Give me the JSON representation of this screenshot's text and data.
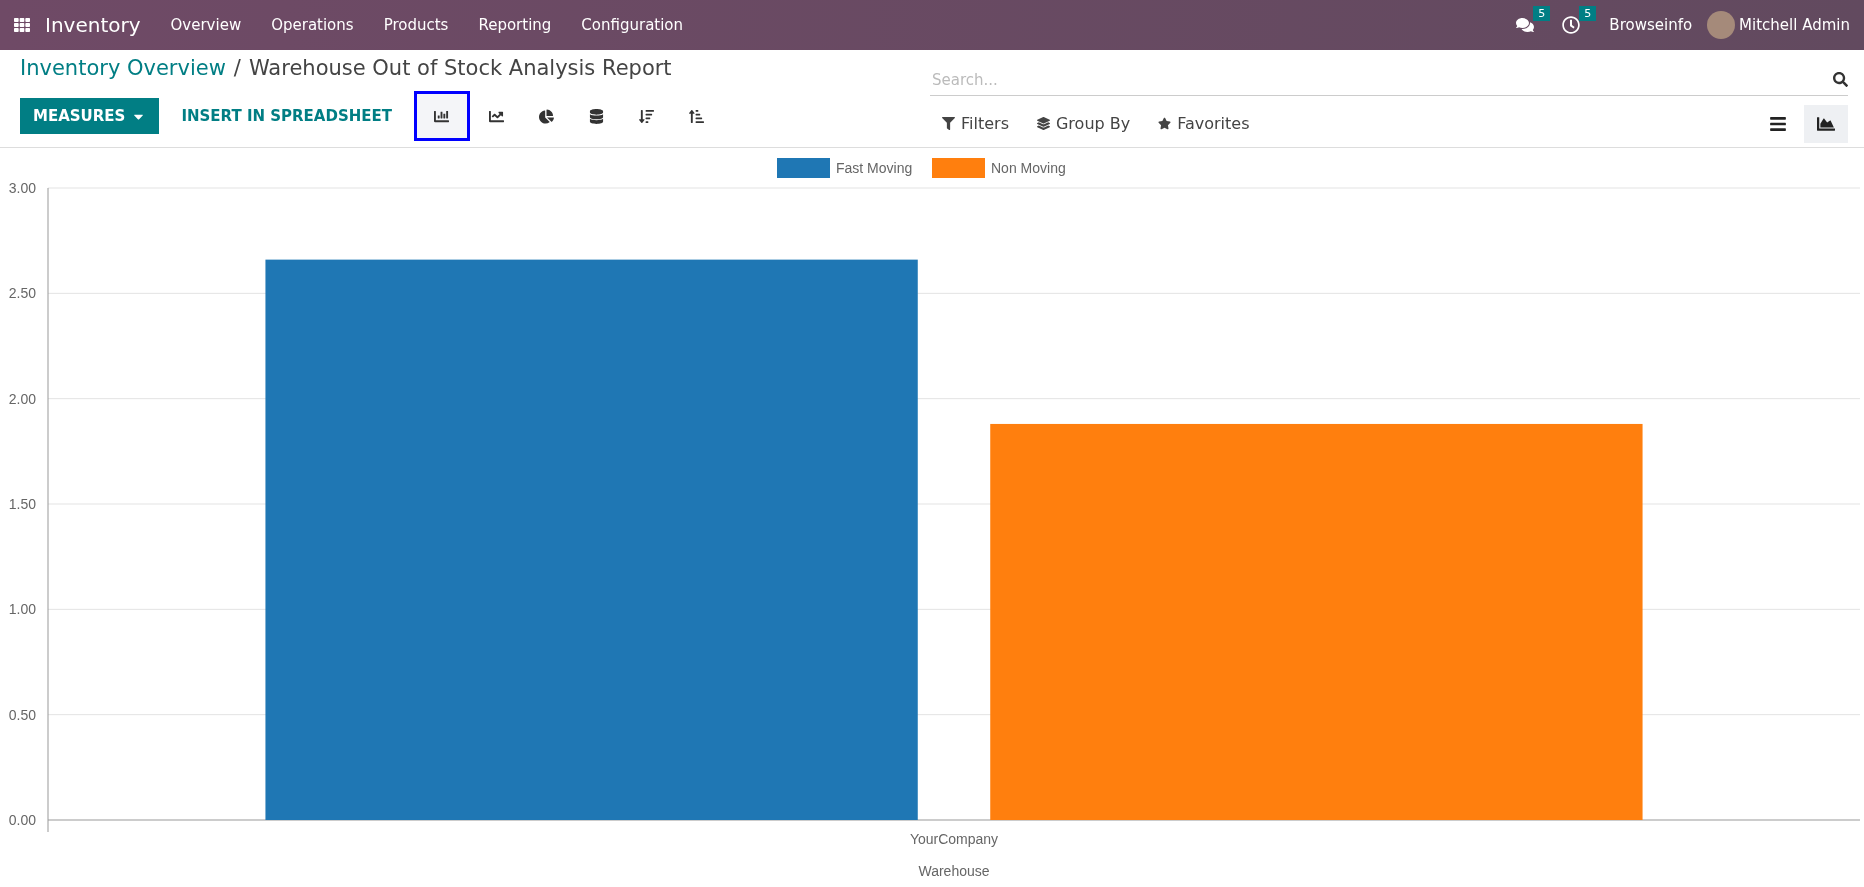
{
  "navbar": {
    "app_name": "Inventory",
    "menu": [
      "Overview",
      "Operations",
      "Products",
      "Reporting",
      "Configuration"
    ],
    "systray": [
      {
        "kind": "messages",
        "badge": "5"
      },
      {
        "kind": "activities",
        "badge": "5"
      }
    ],
    "company": "Browseinfo",
    "user": "Mitchell Admin"
  },
  "breadcrumbs": {
    "parent": "Inventory Overview",
    "separator": "/",
    "current": "Warehouse Out of Stock Analysis Report"
  },
  "search": {
    "placeholder": "Search..."
  },
  "buttons": {
    "measures": "MEASURES",
    "spreadsheet": "INSERT IN SPREADSHEET"
  },
  "chart_tools": [
    {
      "kind": "bar",
      "selected": true
    },
    {
      "kind": "line",
      "selected": false
    },
    {
      "kind": "pie",
      "selected": false
    },
    {
      "kind": "stack",
      "selected": false
    },
    {
      "kind": "sort_desc",
      "selected": false
    },
    {
      "kind": "sort_asc",
      "selected": false
    }
  ],
  "filters": [
    {
      "kind": "filter",
      "label": "Filters"
    },
    {
      "kind": "group",
      "label": "Group By"
    },
    {
      "kind": "favorite",
      "label": "Favorites"
    }
  ],
  "views": [
    {
      "kind": "list",
      "selected": false
    },
    {
      "kind": "graph",
      "selected": true
    }
  ],
  "chart": {
    "chart_data": {
      "type": "bar",
      "grid": true,
      "legend": "top",
      "xlabel": "Warehouse",
      "categories": [
        "YourCompany"
      ],
      "series": [
        {
          "name": "Fast Moving",
          "color": "#1f77b4",
          "values": [
            2.66
          ]
        },
        {
          "name": "Non Moving",
          "color": "#ff7f0e",
          "values": [
            1.88
          ]
        }
      ],
      "ylim": [
        0,
        3
      ],
      "yticks": [
        {
          "value": 0,
          "label": "0.00"
        },
        {
          "value": 0.5,
          "label": "0.50"
        },
        {
          "value": 1,
          "label": "1.00"
        },
        {
          "value": 1.5,
          "label": "1.50"
        },
        {
          "value": 2,
          "label": "2.00"
        },
        {
          "value": 2.5,
          "label": "2.50"
        },
        {
          "value": 3,
          "label": "3.00"
        }
      ]
    }
  }
}
